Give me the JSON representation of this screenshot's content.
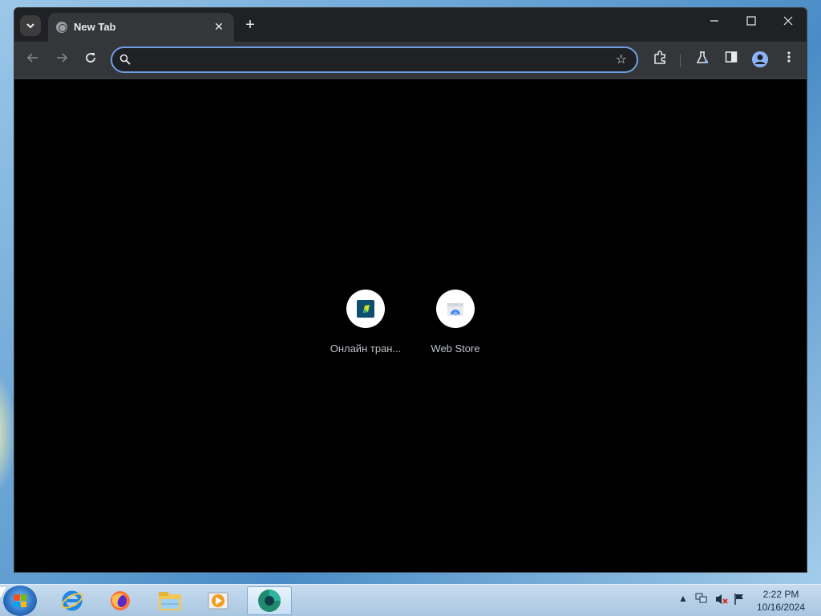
{
  "browser": {
    "tab": {
      "title": "New Tab"
    },
    "toolbar": {
      "address_value": "",
      "address_placeholder": ""
    },
    "colors": {
      "accent": "#6f9fe4",
      "frame": "#202124",
      "toolbar": "#35363a",
      "content": "#000000"
    }
  },
  "shortcuts": [
    {
      "label": "Онлайн тран...",
      "icon": "translation-app-icon"
    },
    {
      "label": "Web Store",
      "icon": "chrome-web-store-icon"
    }
  ],
  "taskbar": {
    "apps": [
      {
        "name": "internet-explorer-icon"
      },
      {
        "name": "firefox-icon"
      },
      {
        "name": "file-explorer-icon"
      },
      {
        "name": "media-player-icon"
      },
      {
        "name": "chrome-dev-icon",
        "active": true
      }
    ],
    "clock": {
      "time": "2:22 PM",
      "date": "10/16/2024"
    }
  }
}
